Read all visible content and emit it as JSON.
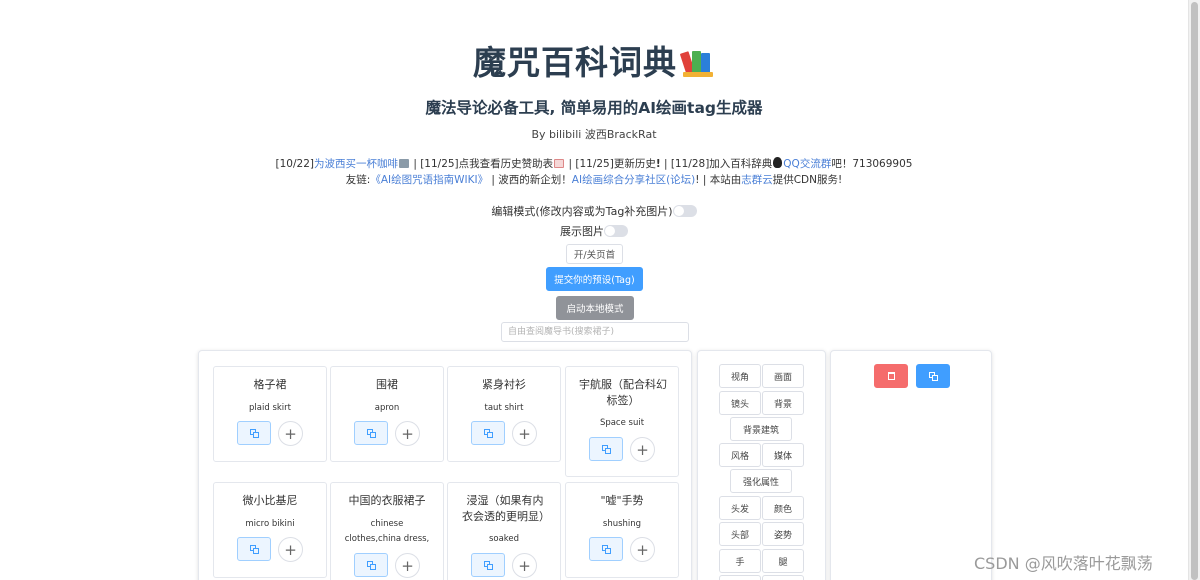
{
  "header": {
    "title": "魔咒百科词典",
    "subtitle": "魔法导论必备工具, 简单易用的AI绘画tag生成器",
    "author": "By bilibili 波西BrackRat"
  },
  "news": {
    "part1": "[10/22]",
    "link_coffee": "为波西买一杯咖啡",
    "part2": " | [11/25]点我查看历史赞助表",
    "part3": " | [11/25]更新历史",
    "part4": " | [11/28]加入百科辞典",
    "link_qq": "QQ交流群",
    "part5": "吧！713069905",
    "line2_a": "友链:",
    "link_wiki": "《AI绘图咒语指南WIKI》",
    "line2_b": " | 波西的新企划！",
    "link_forum": "AI绘画综合分享社区(论坛)",
    "line2_c": "! | 本站由",
    "link_cdn": "志群云",
    "line2_d": "提供CDN服务!"
  },
  "controls": {
    "edit_mode_label": "编辑模式(修改内容或为Tag补充图片)",
    "show_images_label": "展示图片",
    "toggle_header_button": "开/关页首",
    "submit_preset_button": "提交你的预设(Tag)",
    "local_mode_button": "启动本地模式",
    "search_placeholder": "自由查阅魔导书(搜索裙子)"
  },
  "cards": [
    {
      "cn": "格子裙",
      "en": "plaid skirt"
    },
    {
      "cn": "围裙",
      "en": "apron"
    },
    {
      "cn": "紧身衬衫",
      "en": "taut shirt"
    },
    {
      "cn": "宇航服（配合科幻标签）",
      "en": "Space suit"
    },
    {
      "cn": "微小比基尼",
      "en": "micro bikini"
    },
    {
      "cn": "中国的衣服裙子",
      "en": "chinese clothes,china dress,"
    },
    {
      "cn": "浸湿（如果有内衣会透的更明显）",
      "en": "soaked"
    },
    {
      "cn": "\"嘘\"手势",
      "en": "shushing"
    }
  ],
  "categories": [
    "视角",
    "画面",
    "镜头",
    "背景",
    "背景建筑",
    "风格",
    "媒体",
    "强化属性",
    "头发",
    "颜色",
    "头部",
    "姿势",
    "手",
    "腿"
  ],
  "icons": {
    "books": "books-icon",
    "copy": "copy-icon",
    "plus": "plus-icon",
    "delete": "trash-icon"
  },
  "colors": {
    "primary": "#409eff",
    "danger": "#f56c6c",
    "info": "#909399",
    "link": "#4a7fd6"
  },
  "watermark": "CSDN @风吹落叶花飘荡"
}
